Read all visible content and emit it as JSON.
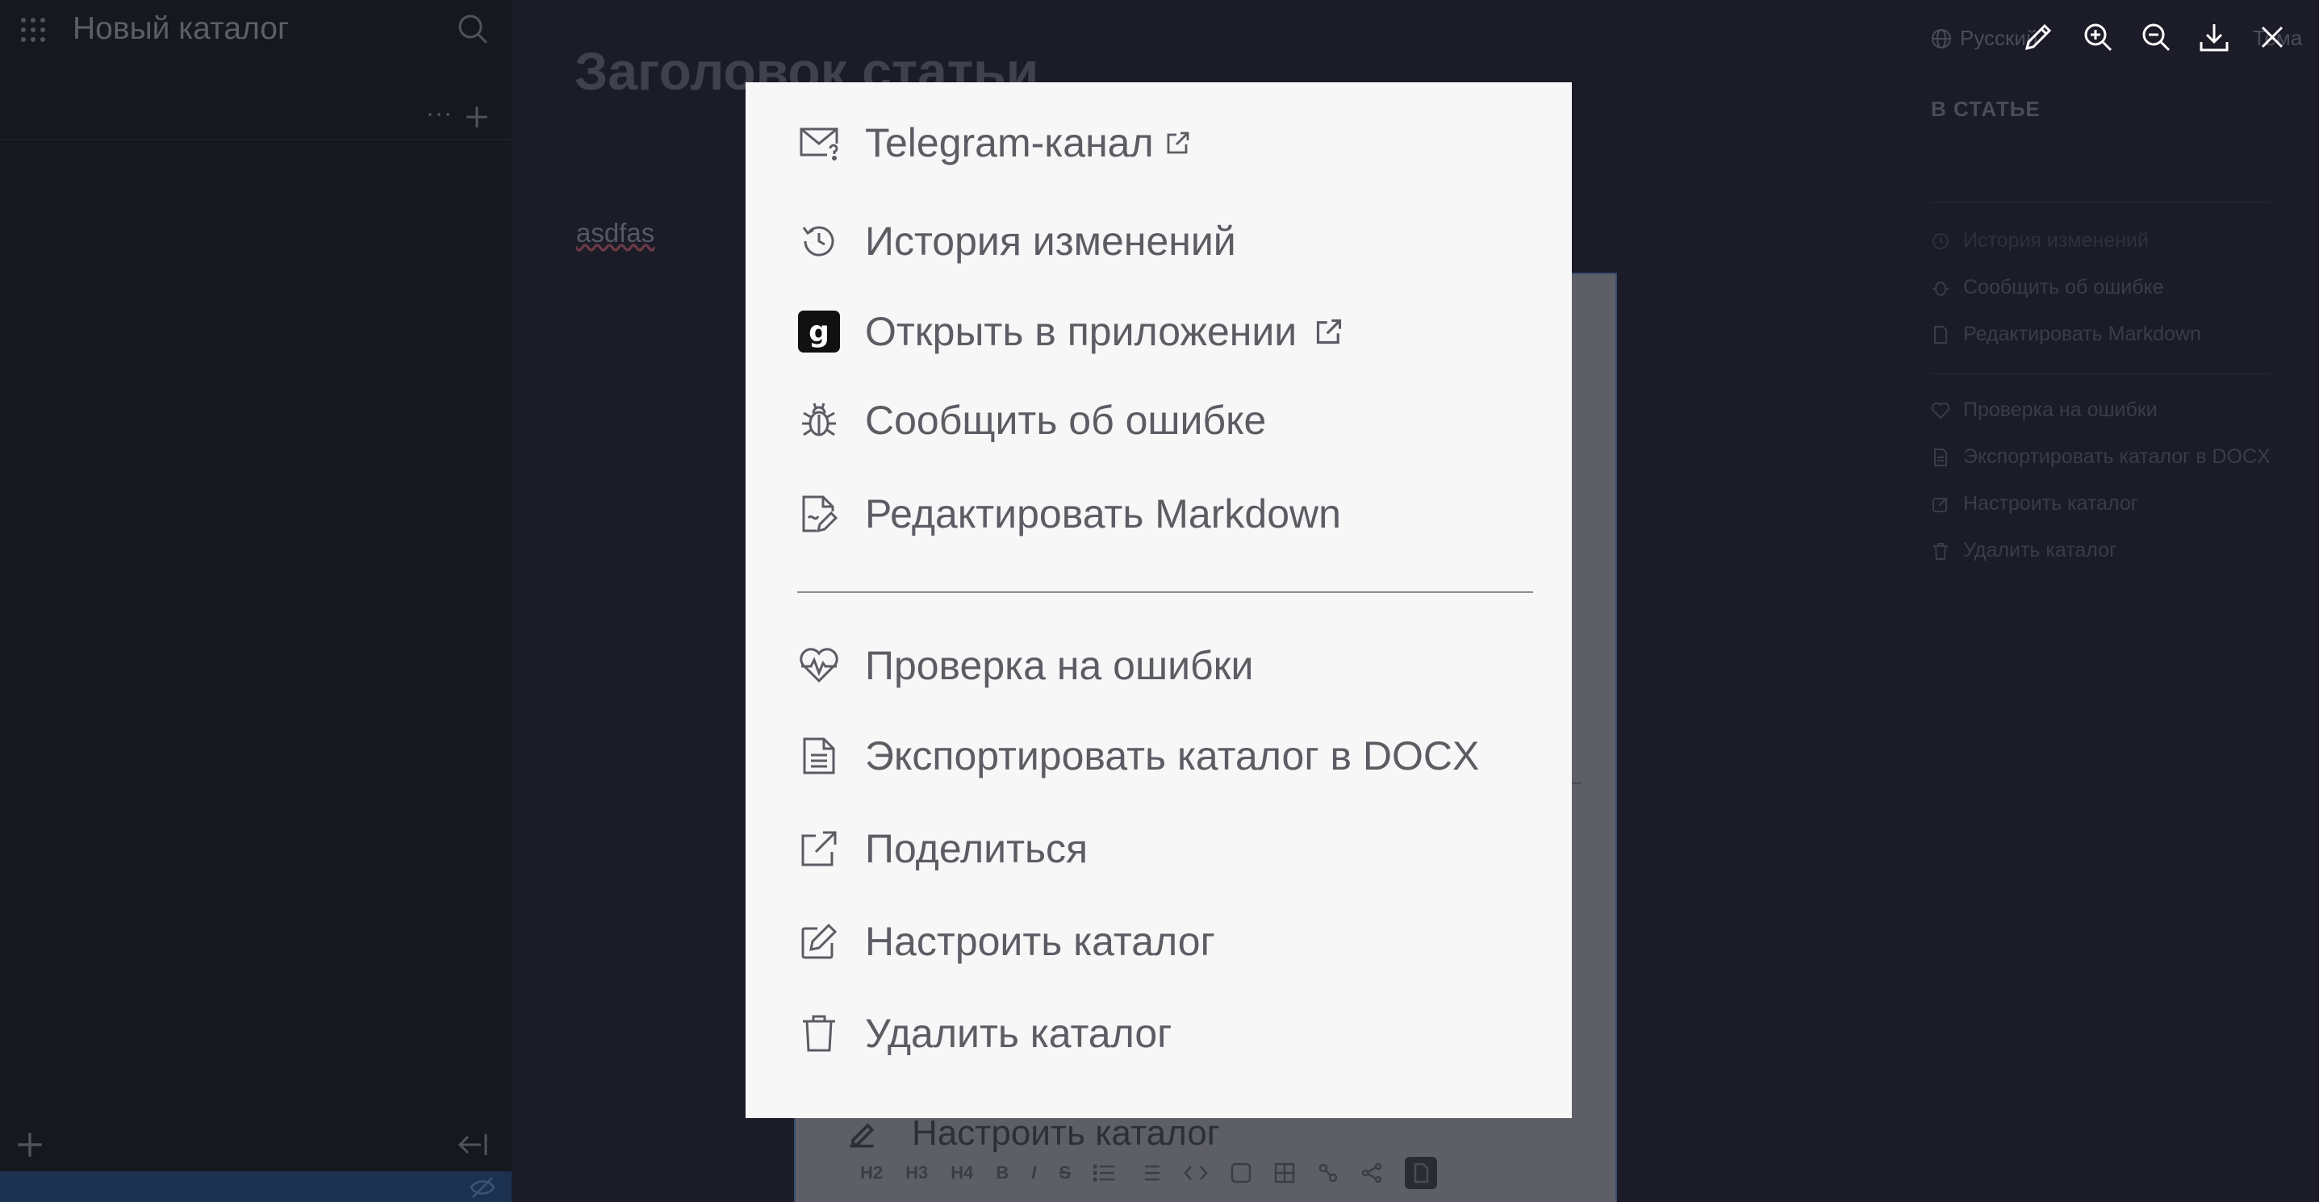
{
  "app": {
    "catalog_title": "Новый каталог",
    "sidebar_more": "···"
  },
  "article": {
    "title": "Заголовок статьи",
    "body_text": "asdfas",
    "behind_menu_item": "Настроить каталог"
  },
  "editor_toolbar": [
    "H2",
    "H3",
    "H4",
    "B",
    "I",
    "S"
  ],
  "header": {
    "language": "Русский",
    "theme": "Тема"
  },
  "right_panel": {
    "heading": "В СТАТЬЕ",
    "items": [
      {
        "label": "История изменений",
        "icon": "history-icon"
      },
      {
        "label": "Сообщить об ошибке",
        "icon": "bug-icon"
      },
      {
        "label": "Редактировать Markdown",
        "icon": "markdown-edit-icon"
      },
      {
        "label": "Проверка на ошибки",
        "icon": "heart-pulse-icon"
      },
      {
        "label": "Экспортировать каталог в DOCX",
        "icon": "document-icon"
      },
      {
        "label": "Настроить каталог",
        "icon": "edit-icon"
      },
      {
        "label": "Удалить каталог",
        "icon": "trash-icon"
      }
    ]
  },
  "menu": {
    "items": [
      {
        "label": "Telegram-канал",
        "icon": "mail-question-icon",
        "external": true
      },
      {
        "label": "История изменений",
        "icon": "history-icon"
      },
      {
        "label": "Открыть в приложении",
        "icon": "gramax-logo-icon",
        "logo_letter": "g",
        "external": true
      },
      {
        "label": "Сообщить об ошибке",
        "icon": "bug-icon"
      },
      {
        "label": "Редактировать Markdown",
        "icon": "markdown-edit-icon"
      },
      {
        "label": "Проверка на ошибки",
        "icon": "heart-pulse-icon"
      },
      {
        "label": "Экспортировать каталог в DOCX",
        "icon": "document-icon"
      },
      {
        "label": "Поделиться",
        "icon": "share-icon"
      },
      {
        "label": "Настроить каталог",
        "icon": "edit-icon"
      },
      {
        "label": "Удалить каталог",
        "icon": "trash-icon"
      }
    ]
  },
  "colors": {
    "background": "#1b1c27",
    "sidebar": "#16171f",
    "menu_background": "#f7f7f8",
    "menu_text": "#5b5d63",
    "status_bar": "#1d3150"
  }
}
